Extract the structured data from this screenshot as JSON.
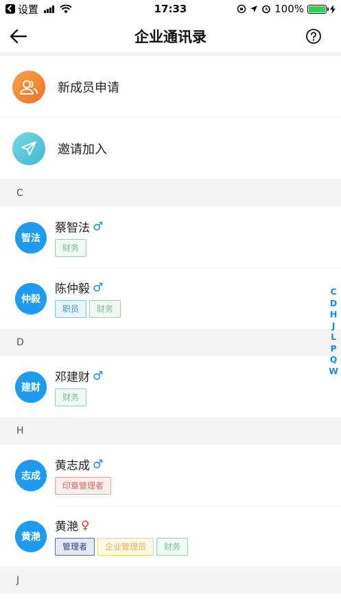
{
  "status_bar": {
    "back_app": "设置",
    "time": "17:33",
    "battery": "100%"
  },
  "nav": {
    "title": "企业通讯录"
  },
  "actions": [
    {
      "label": "新成员申请",
      "icon": "users-icon",
      "color": "#f28a36"
    },
    {
      "label": "邀请加入",
      "icon": "paper-plane-icon",
      "color": "#4cc0d8"
    }
  ],
  "sections": [
    {
      "letter": "C",
      "contacts": [
        {
          "avatar": "智法",
          "name": "蔡智法",
          "gender": "♂",
          "tags": [
            "财务"
          ]
        },
        {
          "avatar": "仲毅",
          "name": "陈仲毅",
          "gender": "♂",
          "tags": [
            "职员",
            "财务"
          ]
        }
      ]
    },
    {
      "letter": "D",
      "contacts": [
        {
          "avatar": "建财",
          "name": "邓建财",
          "gender": "♂",
          "tags": [
            "财务"
          ]
        }
      ]
    },
    {
      "letter": "H",
      "contacts": [
        {
          "avatar": "志成",
          "name": "黄志成",
          "gender": "♂",
          "tags": [
            "印章管理者"
          ]
        },
        {
          "avatar": "黄滟",
          "name": "黄滟",
          "gender": "♀",
          "tags": [
            "管理者",
            "企业管理员",
            "财务"
          ]
        }
      ]
    },
    {
      "letter": "J",
      "contacts": []
    }
  ],
  "index_letters": [
    "C",
    "D",
    "H",
    "J",
    "L",
    "P",
    "Q",
    "W"
  ],
  "colors": {
    "avatar_blue": "#1d9bf0",
    "accent_blue": "#1e88e5"
  }
}
